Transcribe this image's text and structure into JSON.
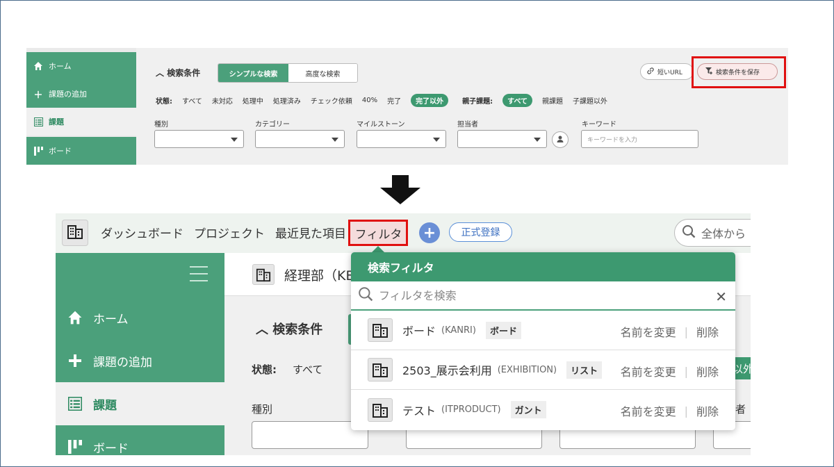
{
  "top": {
    "sidebar": [
      {
        "label": "ホーム",
        "icon": "home-icon"
      },
      {
        "label": "課題の追加",
        "icon": "plus-icon"
      },
      {
        "label": "課題",
        "icon": "list-icon",
        "active": true
      },
      {
        "label": "ボード",
        "icon": "board-icon"
      }
    ],
    "search_title": "検索条件",
    "mode_simple": "シンプルな検索",
    "mode_advanced": "高度な検索",
    "short_url": "短いURL",
    "save_conditions": "検索条件を保存",
    "status_label": "状態:",
    "statuses": [
      "すべて",
      "未対応",
      "処理中",
      "処理済み",
      "チェック依頼",
      "40%",
      "完了"
    ],
    "status_selected": "完了以外",
    "parent_label": "親子課題:",
    "parent_selected": "すべて",
    "parent_options": [
      "親課題",
      "子課題以外"
    ],
    "fields": [
      "種別",
      "カテゴリー",
      "マイルストーン",
      "担当者",
      "キーワード"
    ],
    "keyword_placeholder": "キーワードを入力"
  },
  "bottom": {
    "nav": [
      "ダッシュボード",
      "プロジェクト",
      "最近見た項目"
    ],
    "nav_filter": "フィルタ",
    "register": "正式登録",
    "global_search": "全体から",
    "sidebar": [
      {
        "label": "ホーム",
        "icon": "home-icon"
      },
      {
        "label": "課題の追加",
        "icon": "plus-icon"
      },
      {
        "label": "課題",
        "icon": "list-icon",
        "active": true
      },
      {
        "label": "ボード",
        "icon": "board-icon"
      }
    ],
    "project_title": "経理部（KE",
    "search_title": "検索条件",
    "status_label": "状態:",
    "status_all": "すべて",
    "status_chip": "以外",
    "kind_label": "種別",
    "assignee_tail": "者",
    "popup": {
      "title": "検索フィルタ",
      "search_placeholder": "フィルタを検索",
      "rows": [
        {
          "name": "ボード",
          "key": "(KANRI)",
          "type": "ボード",
          "rename": "名前を変更",
          "delete": "削除"
        },
        {
          "name": "2503_展示会利用",
          "key": "(EXHIBITION)",
          "type": "リスト",
          "rename": "名前を変更",
          "delete": "削除"
        },
        {
          "name": "テスト",
          "key": "(ITPRODUCT)",
          "type": "ガント",
          "rename": "名前を変更",
          "delete": "削除"
        }
      ]
    }
  },
  "colors": {
    "accent": "#4ba07b",
    "highlight": "#e01010",
    "link": "#3a6ec0"
  }
}
